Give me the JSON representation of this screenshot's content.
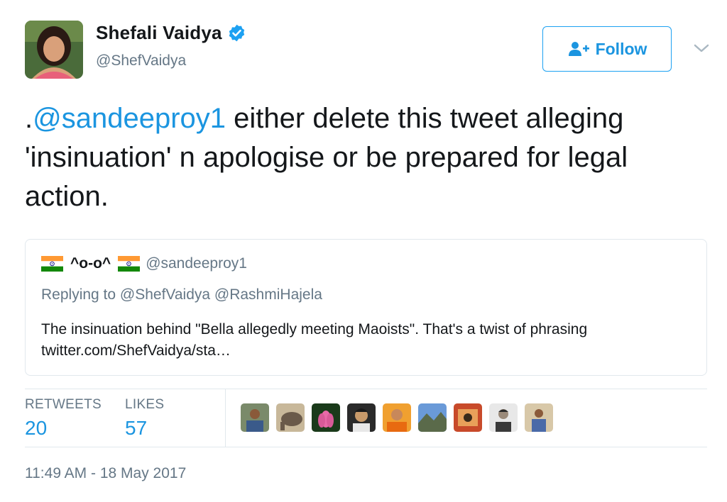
{
  "tweet": {
    "display_name": "Shefali Vaidya",
    "handle": "@ShefVaidya",
    "verified": true,
    "follow_label": "Follow",
    "text_prefix": ".",
    "text_mention": "@sandeeproy1",
    "text_rest": " either delete this tweet alleging 'insinuation' n apologise or be prepared for legal action."
  },
  "quoted": {
    "display_name": "^o-o^",
    "handle": "@sandeeproy1",
    "replying_to": "Replying to @ShefVaidya @RashmiHajela",
    "text_line1": "The insinuation behind \"Bella allegedly meeting Maoists\". That's a twist of phrasing",
    "text_line2": "twitter.com/ShefVaidya/sta…"
  },
  "stats": {
    "retweets_label": "RETWEETS",
    "retweets_value": "20",
    "likes_label": "LIKES",
    "likes_value": "57"
  },
  "timestamp": "11:49 AM - 18 May 2017",
  "colors": {
    "accent": "#1b95e0",
    "muted": "#657786",
    "text": "#14171a",
    "border": "#e1e8ed"
  }
}
